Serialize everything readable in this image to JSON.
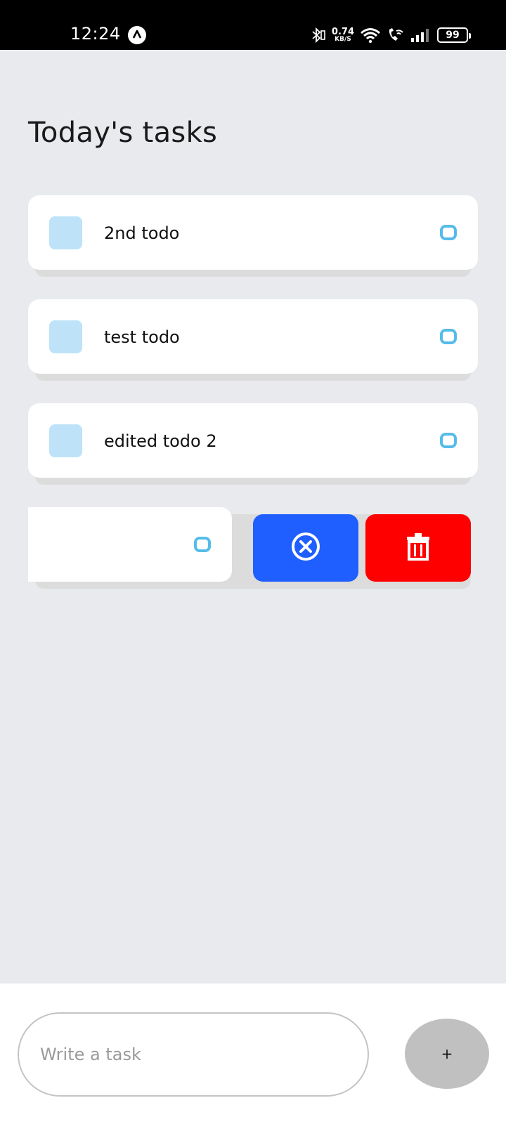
{
  "status_bar": {
    "time": "12:24",
    "net_speed_value": "0.74",
    "net_speed_unit": "KB/S",
    "battery": "99",
    "icons": [
      "app-notification-icon",
      "bluetooth-icon",
      "wifi-icon",
      "wifi-call-icon",
      "signal-icon",
      "battery-icon"
    ]
  },
  "title": "Today's tasks",
  "tasks": [
    {
      "label": "2nd todo"
    },
    {
      "label": "test todo"
    },
    {
      "label": "edited todo 2"
    }
  ],
  "swiped_task": {
    "actions": [
      {
        "name": "cancel",
        "icon": "close-circle-icon",
        "color": "#1f5eff"
      },
      {
        "name": "delete",
        "icon": "trash-icon",
        "color": "#ff0000"
      }
    ]
  },
  "input": {
    "placeholder": "Write a task",
    "value": ""
  },
  "add_button": {
    "label": "+"
  },
  "colors": {
    "background": "#e8eaed",
    "task_square": "#bee3f8",
    "task_circle": "#55bcea",
    "cancel": "#1f5eff",
    "delete": "#ff0000",
    "add_button": "#c0c0c0"
  }
}
